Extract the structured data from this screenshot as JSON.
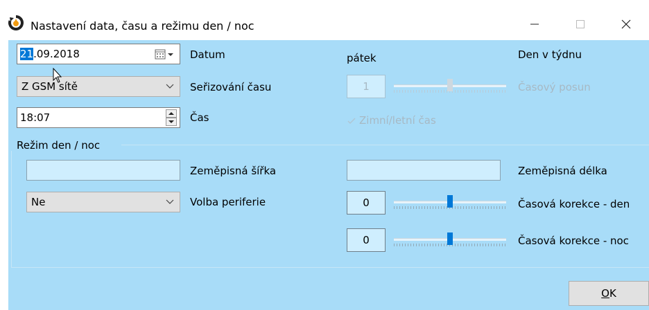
{
  "window": {
    "title": "Nastavení data, času a režimu den / noc",
    "icons": {
      "app": "clock-refresh-icon",
      "minimize": "minimize-icon",
      "maximize": "maximize-icon",
      "close": "close-icon"
    }
  },
  "date": {
    "day_selected": "21",
    "rest": ".09.2018",
    "label": "Datum",
    "icon": "calendar-dropdown-icon"
  },
  "weekday": {
    "value": "pátek",
    "label": "Den v týdnu"
  },
  "time_sync": {
    "value": "Z GSM sítě",
    "label": "Seřizování času"
  },
  "time_shift": {
    "value": "1",
    "label": "Časový posun",
    "slider_fraction": 0.5
  },
  "time": {
    "value": "18:07",
    "label": "Čas",
    "icon": "spinner-updown-icon"
  },
  "dst": {
    "label": "Zimní/letní čas",
    "checked": true
  },
  "daynight": {
    "group_label": "Režim den / noc",
    "latitude_label": "Zeměpisná šířka",
    "latitude_value": "",
    "longitude_label": "Zeměpisná délka",
    "longitude_value": "",
    "peripheral_value": "Ne",
    "peripheral_label": "Volba periferie",
    "day_correction": {
      "value": "0",
      "label": "Časová korekce - den",
      "slider_fraction": 0.5
    },
    "night_correction": {
      "value": "0",
      "label": "Časová korekce - noc",
      "slider_fraction": 0.5
    }
  },
  "ok": {
    "mnemonic": "O",
    "rest": "K"
  },
  "colors": {
    "client_bg": "#a8dcf8",
    "accent": "#0078d7"
  }
}
